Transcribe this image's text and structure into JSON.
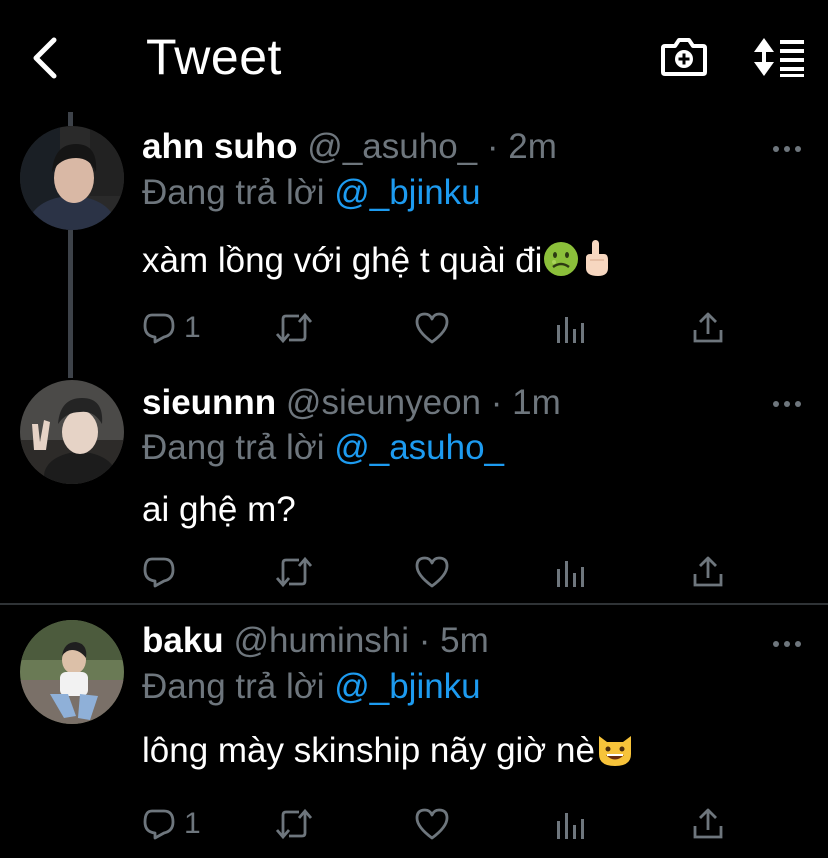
{
  "header": {
    "title": "Tweet",
    "back_icon": "chevron-left-icon",
    "camera_icon": "camera-plus-icon",
    "sort_icon": "sort-lines-icon"
  },
  "colors": {
    "background": "#000000",
    "text": "#ffffff",
    "muted": "#6e767d",
    "accent": "#1d9bf0",
    "separator": "#2f3336"
  },
  "tweets": [
    {
      "display_name": "ahn suho",
      "handle": "@_asuho_",
      "separator": "·",
      "time": "2m",
      "reply_prefix": "Đang trả lời",
      "reply_to": "@_bjinku",
      "text": "xàm lồng với ghệ t quài đi",
      "text_emojis": [
        "nauseated-face",
        "middle-finger"
      ],
      "reply_count": "1"
    },
    {
      "display_name": "sieunnn",
      "handle": "@sieunyeon",
      "separator": "·",
      "time": "1m",
      "reply_prefix": "Đang trả lời",
      "reply_to": "@_asuho_",
      "text": "ai ghệ m?",
      "text_emojis": [],
      "reply_count": ""
    },
    {
      "display_name": "baku",
      "handle": "@huminshi",
      "separator": "·",
      "time": "5m",
      "reply_prefix": "Đang trả lời",
      "reply_to": "@_bjinku",
      "text": "lông mày skinship nãy giờ nè",
      "text_emojis": [
        "grinning-cat"
      ],
      "reply_count": "1"
    }
  ]
}
